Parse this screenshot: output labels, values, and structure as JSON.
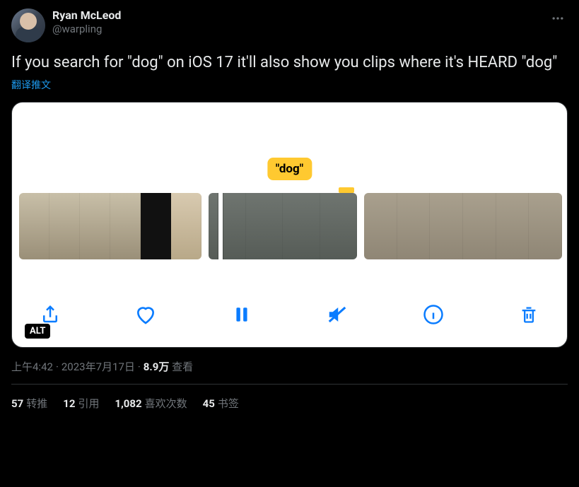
{
  "header": {
    "display_name": "Ryan McLeod",
    "handle": "@warpling"
  },
  "tweet_text": "If you search for \"dog\" on iOS 17 it'll also show you clips where it's HEARD \"dog\"",
  "translate_label": "翻译推文",
  "media": {
    "tooltip_text": "\"dog\"",
    "alt_badge": "ALT"
  },
  "meta": {
    "time": "上午4:42",
    "date": "2023年7月17日",
    "views_number": "8.9万",
    "views_label": "查看"
  },
  "stats": {
    "retweets_num": "57",
    "retweets_label": "转推",
    "quotes_num": "12",
    "quotes_label": "引用",
    "likes_num": "1,082",
    "likes_label": "喜欢次数",
    "bookmarks_num": "45",
    "bookmarks_label": "书签"
  }
}
